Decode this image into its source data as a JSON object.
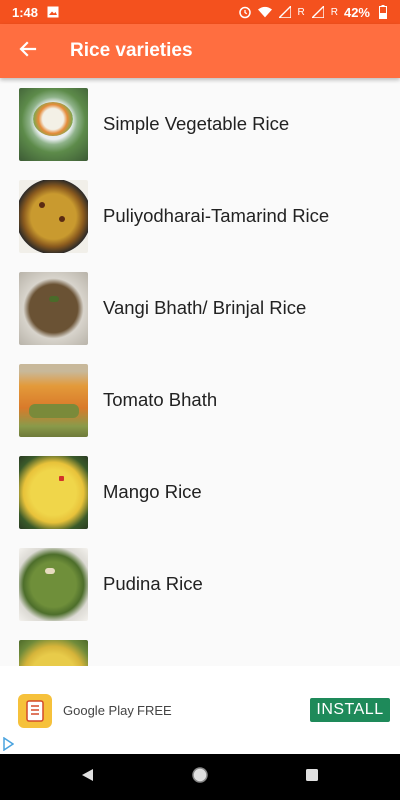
{
  "status_bar": {
    "time": "1:48",
    "signal_r1": "R",
    "signal_r2": "R",
    "battery": "42%",
    "icons": [
      "image-icon",
      "alarm-icon",
      "wifi-icon",
      "signal-icon",
      "signal-icon",
      "battery-icon"
    ]
  },
  "app_bar": {
    "title": "Rice varieties",
    "back_icon": "arrow-back-icon",
    "background": "#ff6e40"
  },
  "recipes": [
    {
      "label": "Simple Vegetable Rice"
    },
    {
      "label": "Puliyodharai-Tamarind Rice"
    },
    {
      "label": "Vangi Bhath/ Brinjal Rice"
    },
    {
      "label": "Tomato Bhath"
    },
    {
      "label": "Mango Rice"
    },
    {
      "label": "Pudina Rice"
    }
  ],
  "ad": {
    "store": "Google Play",
    "price": "FREE",
    "install_label": "INSTALL",
    "install_color": "#1e8a5a"
  },
  "nav_bar": {
    "icons": [
      "back-triangle-icon",
      "home-circle-icon",
      "recents-square-icon"
    ]
  }
}
